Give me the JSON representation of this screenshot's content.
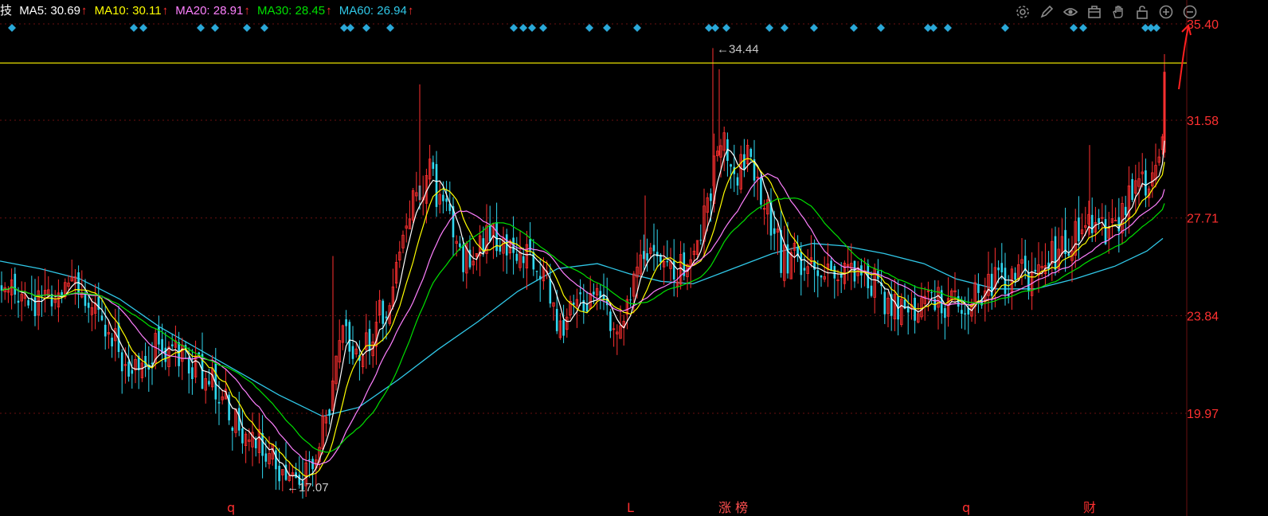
{
  "legend": {
    "prefix": "技",
    "items": [
      {
        "label": "MA5:",
        "value": "30.69",
        "arrow": "↑",
        "color": "#ffffff"
      },
      {
        "label": "MA10:",
        "value": "30.11",
        "arrow": "↑",
        "color": "#ffff00"
      },
      {
        "label": "MA20:",
        "value": "28.91",
        "arrow": "↑",
        "color": "#ff80ff"
      },
      {
        "label": "MA30:",
        "value": "28.45",
        "arrow": "↑",
        "color": "#00e000"
      },
      {
        "label": "MA60:",
        "value": "26.94",
        "arrow": "↑",
        "color": "#30c8e8"
      }
    ]
  },
  "toolbar": {
    "icons": [
      "gear-icon",
      "pen-icon",
      "eye-icon",
      "toolbox-icon",
      "hand-icon",
      "lock-icon",
      "zoom-in-icon",
      "zoom-out-icon"
    ]
  },
  "colors": {
    "background": "#000000",
    "up": "#ff3030",
    "down": "#30d8f0",
    "grid": "#6a1010",
    "axis_text": "#ff3030",
    "marker": "#2aa8d8",
    "price_line": "#e8e000",
    "annotation": "#c8c8c8"
  },
  "chart_data": {
    "type": "candlestick",
    "axis_ticks": [
      "35.40",
      "31.58",
      "27.71",
      "23.84",
      "19.97"
    ],
    "ylim": [
      16.5,
      36.0
    ],
    "xlim": [
      0,
      1490
    ],
    "horizontal_line": 33.85,
    "annotations": [
      {
        "text": "←34.44",
        "x": 900,
        "value": 34.44
      },
      {
        "text": "←17.07",
        "x": 360,
        "value": 17.07
      }
    ],
    "bottom_labels": [
      {
        "text": "q",
        "x": 285,
        "color": "#ff3030"
      },
      {
        "text": "L",
        "x": 787,
        "color": "#ff3030"
      },
      {
        "text": "涨 榜",
        "x": 902,
        "color": "#ff5050"
      },
      {
        "text": "q",
        "x": 1208,
        "color": "#ff3030"
      },
      {
        "text": "财",
        "x": 1360,
        "color": "#ff3030"
      }
    ],
    "markers_x": [
      15,
      168,
      180,
      252,
      270,
      310,
      332,
      432,
      440,
      460,
      490,
      645,
      657,
      668,
      682,
      740,
      762,
      800,
      890,
      898,
      912,
      966,
      985,
      1022,
      1072,
      1106,
      1165,
      1172,
      1190,
      1262,
      1348,
      1360,
      1438,
      1445,
      1452
    ],
    "anchors": [
      [
        0,
        24.8
      ],
      [
        30,
        24.5
      ],
      [
        60,
        24.3
      ],
      [
        90,
        24.7
      ],
      [
        105,
        24.9
      ],
      [
        130,
        23.5
      ],
      [
        160,
        21.9
      ],
      [
        200,
        22.6
      ],
      [
        230,
        22.2
      ],
      [
        260,
        21.4
      ],
      [
        300,
        19.4
      ],
      [
        340,
        18.2
      ],
      [
        370,
        17.4
      ],
      [
        395,
        17.8
      ],
      [
        415,
        20.5
      ],
      [
        430,
        23.0
      ],
      [
        450,
        21.8
      ],
      [
        470,
        23.6
      ],
      [
        490,
        24.5
      ],
      [
        510,
        27.5
      ],
      [
        537,
        29.6
      ],
      [
        560,
        27.8
      ],
      [
        580,
        25.9
      ],
      [
        600,
        27.0
      ],
      [
        630,
        26.7
      ],
      [
        660,
        26.1
      ],
      [
        680,
        25.6
      ],
      [
        700,
        23.5
      ],
      [
        720,
        24.1
      ],
      [
        750,
        24.4
      ],
      [
        765,
        23.5
      ],
      [
        790,
        24.2
      ],
      [
        810,
        26.3
      ],
      [
        830,
        25.8
      ],
      [
        850,
        25.6
      ],
      [
        870,
        25.5
      ],
      [
        890,
        28.7
      ],
      [
        905,
        31.0
      ],
      [
        920,
        29.2
      ],
      [
        940,
        30.5
      ],
      [
        960,
        28.3
      ],
      [
        980,
        26.2
      ],
      [
        1000,
        26.0
      ],
      [
        1030,
        25.6
      ],
      [
        1060,
        25.8
      ],
      [
        1090,
        25.5
      ],
      [
        1110,
        24.5
      ],
      [
        1130,
        23.8
      ],
      [
        1160,
        24.5
      ],
      [
        1190,
        24.3
      ],
      [
        1220,
        24.6
      ],
      [
        1250,
        25.1
      ],
      [
        1280,
        25.4
      ],
      [
        1310,
        25.7
      ],
      [
        1340,
        26.8
      ],
      [
        1370,
        27.6
      ],
      [
        1390,
        27.1
      ],
      [
        1410,
        28.0
      ],
      [
        1430,
        28.9
      ],
      [
        1445,
        29.3
      ],
      [
        1460,
        30.9
      ]
    ],
    "ma60_points": [
      [
        0,
        26.0
      ],
      [
        50,
        25.7
      ],
      [
        100,
        25.3
      ],
      [
        150,
        24.5
      ],
      [
        200,
        23.4
      ],
      [
        250,
        22.5
      ],
      [
        300,
        21.6
      ],
      [
        350,
        20.7
      ],
      [
        405,
        19.85
      ],
      [
        450,
        20.2
      ],
      [
        500,
        21.3
      ],
      [
        550,
        22.5
      ],
      [
        600,
        23.6
      ],
      [
        650,
        24.8
      ],
      [
        700,
        25.7
      ],
      [
        750,
        25.9
      ],
      [
        790,
        25.5
      ],
      [
        830,
        25.2
      ],
      [
        870,
        25.1
      ],
      [
        920,
        25.7
      ],
      [
        970,
        26.3
      ],
      [
        1020,
        26.7
      ],
      [
        1060,
        26.6
      ],
      [
        1110,
        26.3
      ],
      [
        1160,
        25.9
      ],
      [
        1200,
        25.3
      ],
      [
        1250,
        24.9
      ],
      [
        1300,
        24.9
      ],
      [
        1350,
        25.3
      ],
      [
        1400,
        25.8
      ],
      [
        1440,
        26.4
      ],
      [
        1460,
        26.9
      ]
    ],
    "last_candle": {
      "x": 1462,
      "open": 30.3,
      "close": 33.5,
      "high": 34.2,
      "low": 30.1
    },
    "series_ma": [
      {
        "key": "MA5",
        "period": 5,
        "color": "#ffffff"
      },
      {
        "key": "MA10",
        "period": 10,
        "color": "#ffff00"
      },
      {
        "key": "MA20",
        "period": 20,
        "color": "#ff80ff"
      },
      {
        "key": "MA30",
        "period": 30,
        "color": "#00e000"
      }
    ]
  }
}
